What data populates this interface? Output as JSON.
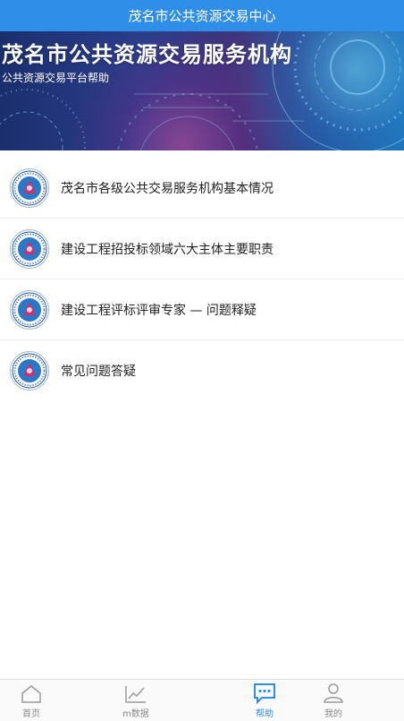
{
  "header": {
    "title": "茂名市公共资源交易中心"
  },
  "banner": {
    "title": "茂名市公共资源交易服务机构",
    "subtitle": "公共资源交易平台帮助"
  },
  "items": [
    {
      "label": "茂名市各级公共交易服务机构基本情况",
      "icon": "maoming-logo-icon"
    },
    {
      "label": "建设工程招投标领域六大主体主要职责",
      "icon": "maoming-logo-icon"
    },
    {
      "label": "建设工程评标评审专家 — 问题释疑",
      "icon": "maoming-logo-icon"
    },
    {
      "label": "常见问题答疑",
      "icon": "maoming-logo-icon"
    }
  ],
  "tabs": [
    {
      "label": "首页",
      "icon": "home-icon",
      "active": false
    },
    {
      "label": "m数据",
      "icon": "chart-icon",
      "active": false
    },
    {
      "label": "帮助",
      "icon": "chat-icon",
      "active": true
    },
    {
      "label": "我的",
      "icon": "user-icon",
      "active": false
    }
  ],
  "colors": {
    "accent": "#2f8ee8",
    "inactive": "#8a8a8a"
  }
}
